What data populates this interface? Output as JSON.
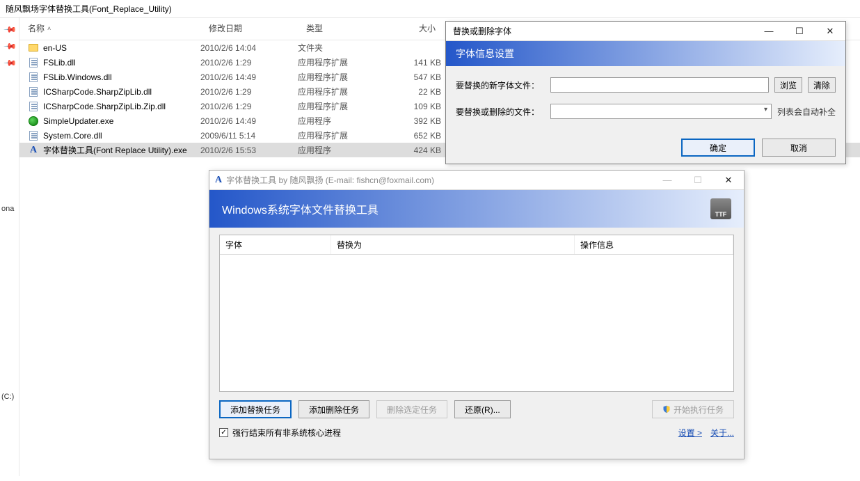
{
  "explorer": {
    "title": "随风飘场字体替换工具(Font_Replace_Utility)",
    "columns": {
      "name": "名称",
      "date": "修改日期",
      "type": "类型",
      "size": "大小"
    },
    "files": [
      {
        "icon": "folder",
        "name": "en-US",
        "date": "2010/2/6 14:04",
        "type": "文件夹",
        "size": ""
      },
      {
        "icon": "dll",
        "name": "FSLib.dll",
        "date": "2010/2/6 1:29",
        "type": "应用程序扩展",
        "size": "141 KB"
      },
      {
        "icon": "dll",
        "name": "FSLib.Windows.dll",
        "date": "2010/2/6 14:49",
        "type": "应用程序扩展",
        "size": "547 KB"
      },
      {
        "icon": "dll",
        "name": "ICSharpCode.SharpZipLib.dll",
        "date": "2010/2/6 1:29",
        "type": "应用程序扩展",
        "size": "22 KB"
      },
      {
        "icon": "dll",
        "name": "ICSharpCode.SharpZipLib.Zip.dll",
        "date": "2010/2/6 1:29",
        "type": "应用程序扩展",
        "size": "109 KB"
      },
      {
        "icon": "exe",
        "name": "SimpleUpdater.exe",
        "date": "2010/2/6 14:49",
        "type": "应用程序",
        "size": "392 KB"
      },
      {
        "icon": "dll",
        "name": "System.Core.dll",
        "date": "2009/6/11 5:14",
        "type": "应用程序扩展",
        "size": "652 KB"
      },
      {
        "icon": "font",
        "name": "字体替换工具(Font Replace Utility).exe",
        "date": "2010/2/6 15:53",
        "type": "应用程序",
        "size": "424 KB",
        "selected": true
      }
    ],
    "side": {
      "ona": "ona",
      "drive": "(C:)"
    }
  },
  "dialog1": {
    "title": "替换或删除字体",
    "banner": "字体信息设置",
    "row1": {
      "label": "要替换的新字体文件：",
      "browse": "浏览",
      "clear": "清除"
    },
    "row2": {
      "label": "要替换或删除的文件：",
      "note": "列表会自动补全"
    },
    "ok": "确定",
    "cancel": "取消"
  },
  "dialog2": {
    "title": "字体替换工具 by 随风飘扬 (E-mail: fishcn@foxmail.com)",
    "banner": "Windows系统字体文件替换工具",
    "ttf": "TTF",
    "th1": "字体",
    "th2": "替换为",
    "th3": "操作信息",
    "btn_add_replace": "添加替换任务",
    "btn_add_delete": "添加删除任务",
    "btn_remove_sel": "删除选定任务",
    "btn_restore": "还原(R)...",
    "btn_execute": "开始执行任务",
    "chk_label": "强行结束所有非系统核心进程",
    "link_settings": "设置 >",
    "link_about": "关于..."
  }
}
